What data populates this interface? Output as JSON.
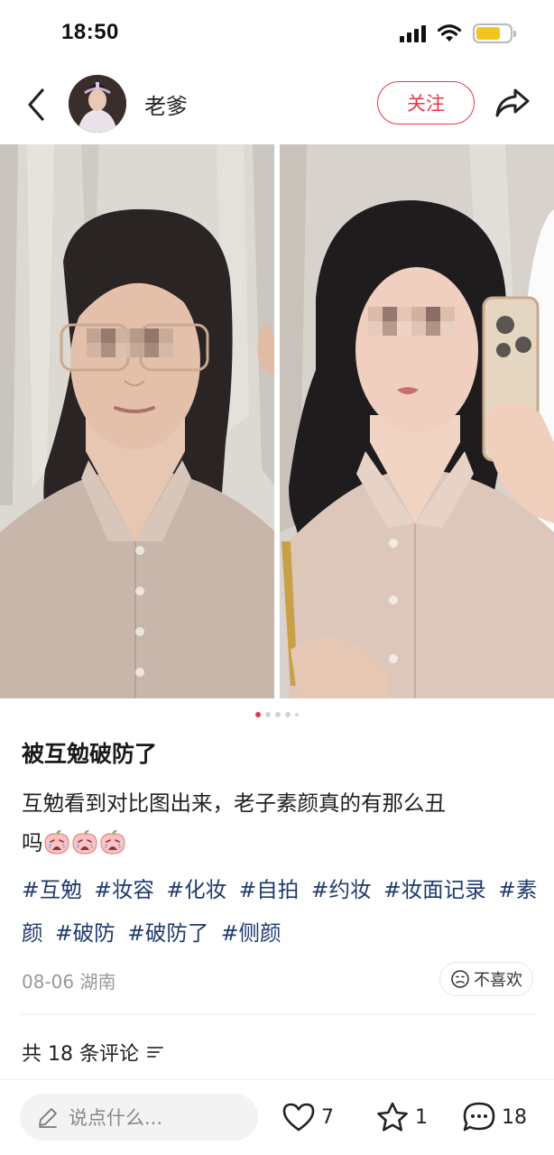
{
  "status_bar": {
    "time": "18:50",
    "icons": [
      "signal-icon",
      "wifi-icon",
      "battery-icon"
    ],
    "battery_color": "#f2c61f"
  },
  "header": {
    "author_name": "老爹",
    "follow_label": "关注",
    "icons": [
      "back-icon",
      "avatar",
      "share-icon"
    ]
  },
  "media": {
    "page_count": 5,
    "current_page": 1
  },
  "post": {
    "title": "被互勉破防了",
    "body_line1": "互勉看到对比图出来，老子素颜真的有那么丑",
    "body_line2": "吗",
    "emoji_name": "crying-peach-emoji",
    "emoji_count": 3,
    "tags": [
      "#互勉",
      "#妆容",
      "#化妆",
      "#自拍",
      "#约妆",
      "#妆面记录",
      "#素颜",
      "#破防",
      "#破防了",
      "#侧颜"
    ],
    "date_location": "08-06 湖南",
    "dislike_label": "不喜欢"
  },
  "comments": {
    "header": "共 18 条评论"
  },
  "bottom_bar": {
    "input_placeholder": "说点什么...",
    "like_count": "7",
    "collect_count": "1",
    "comment_count": "18"
  },
  "colors": {
    "accent": "#e8364b",
    "tag": "#1f3a6e"
  }
}
